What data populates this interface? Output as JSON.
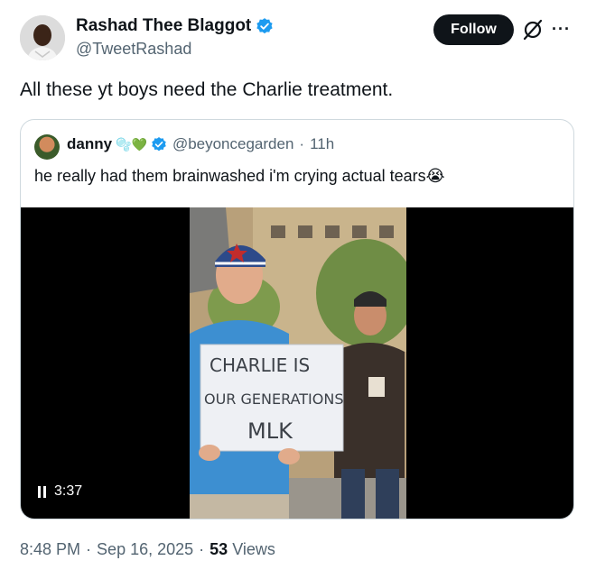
{
  "author": {
    "display_name": "Rashad Thee Blaggot",
    "handle": "@TweetRashad",
    "verified": true
  },
  "follow_label": "Follow",
  "more_label": "···",
  "tweet_text": "All these yt boys need the Charlie treatment.",
  "quoted": {
    "display_name": "danny",
    "emojis": "🫧💚",
    "handle": "@beyoncegarden",
    "separator": "·",
    "time": "11h",
    "text": "he really had them brainwashed i'm crying actual tears",
    "text_emoji": "😭"
  },
  "video": {
    "duration": "3:37",
    "sign_lines": [
      "CHARLIE IS",
      "OUR GENERATIONS",
      "MLK"
    ]
  },
  "footer": {
    "time": "8:48 PM",
    "sep1": "·",
    "date": "Sep 16, 2025",
    "sep2": "·",
    "views_count": "53",
    "views_label": "Views"
  },
  "colors": {
    "verified_blue": "#1d9bf0",
    "follow_bg": "#0f1419",
    "secondary_text": "#536471",
    "border": "#cfd9de"
  }
}
